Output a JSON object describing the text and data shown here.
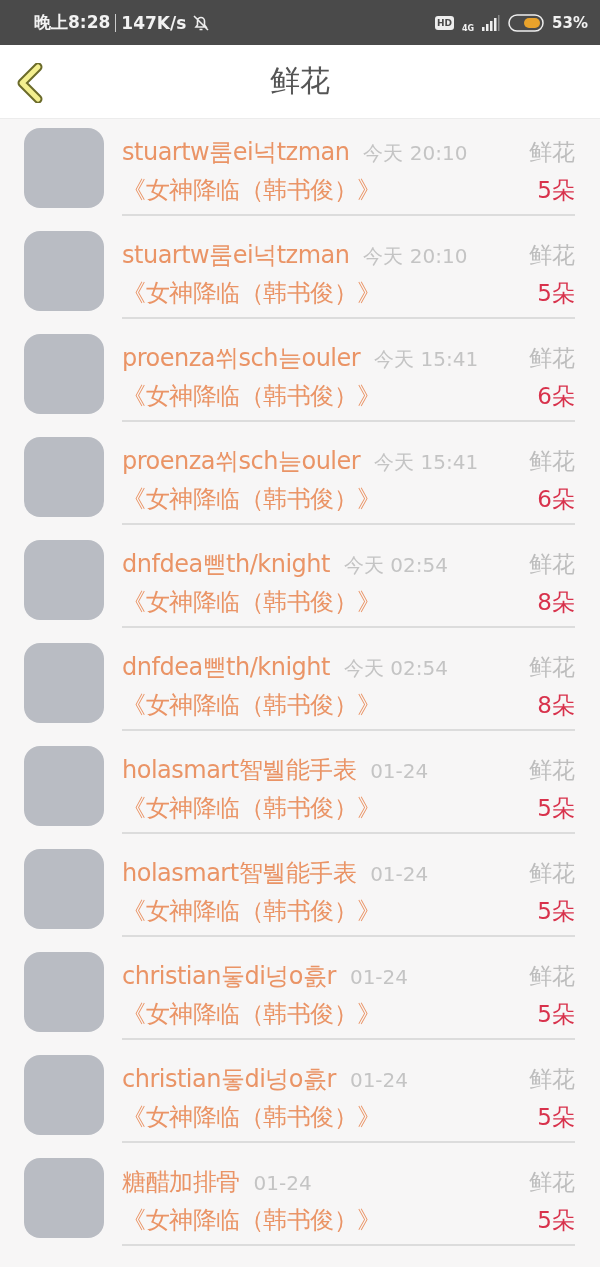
{
  "status_bar": {
    "time": "晚上8:28",
    "speed": "147K/s",
    "hd_badge": "HD",
    "network": "4G",
    "battery": "53%"
  },
  "header": {
    "title": "鲜花"
  },
  "records": [
    {
      "name": "stuartw룸ei넉tzman",
      "time": "今天 20:10",
      "gift": "鲜花",
      "title": "《女神降临（韩书俊）》",
      "count": "5朵"
    },
    {
      "name": "stuartw룸ei넉tzman",
      "time": "今天 20:10",
      "gift": "鲜花",
      "title": "《女神降临（韩书俊）》",
      "count": "5朵"
    },
    {
      "name": "proenza쒸sch늗ouler",
      "time": "今天 15:41",
      "gift": "鲜花",
      "title": "《女神降临（韩书俊）》",
      "count": "6朵"
    },
    {
      "name": "proenza쒸sch늗ouler",
      "time": "今天 15:41",
      "gift": "鲜花",
      "title": "《女神降临（韩书俊）》",
      "count": "6朵"
    },
    {
      "name": "dnfdea뺃th/knight",
      "time": "今天 02:54",
      "gift": "鲜花",
      "title": "《女神降临（韩书俊）》",
      "count": "8朵"
    },
    {
      "name": "dnfdea뺃th/knight",
      "time": "今天 02:54",
      "gift": "鲜花",
      "title": "《女神降临（韩书俊）》",
      "count": "8朵"
    },
    {
      "name": "holasmart智뷀能手表",
      "time": "01-24",
      "gift": "鲜花",
      "title": "《女神降临（韩书俊）》",
      "count": "5朵"
    },
    {
      "name": "holasmart智뷀能手表",
      "time": "01-24",
      "gift": "鲜花",
      "title": "《女神降临（韩书俊）》",
      "count": "5朵"
    },
    {
      "name": "christian둫di넝o흜r",
      "time": "01-24",
      "gift": "鲜花",
      "title": "《女神降临（韩书俊）》",
      "count": "5朵"
    },
    {
      "name": "christian둫di넝o흜r",
      "time": "01-24",
      "gift": "鲜花",
      "title": "《女神降临（韩书俊）》",
      "count": "5朵"
    },
    {
      "name": "糖醋加排骨",
      "time": "01-24",
      "gift": "鲜花",
      "title": "《女神降临（韩书俊）》",
      "count": "5朵"
    }
  ]
}
